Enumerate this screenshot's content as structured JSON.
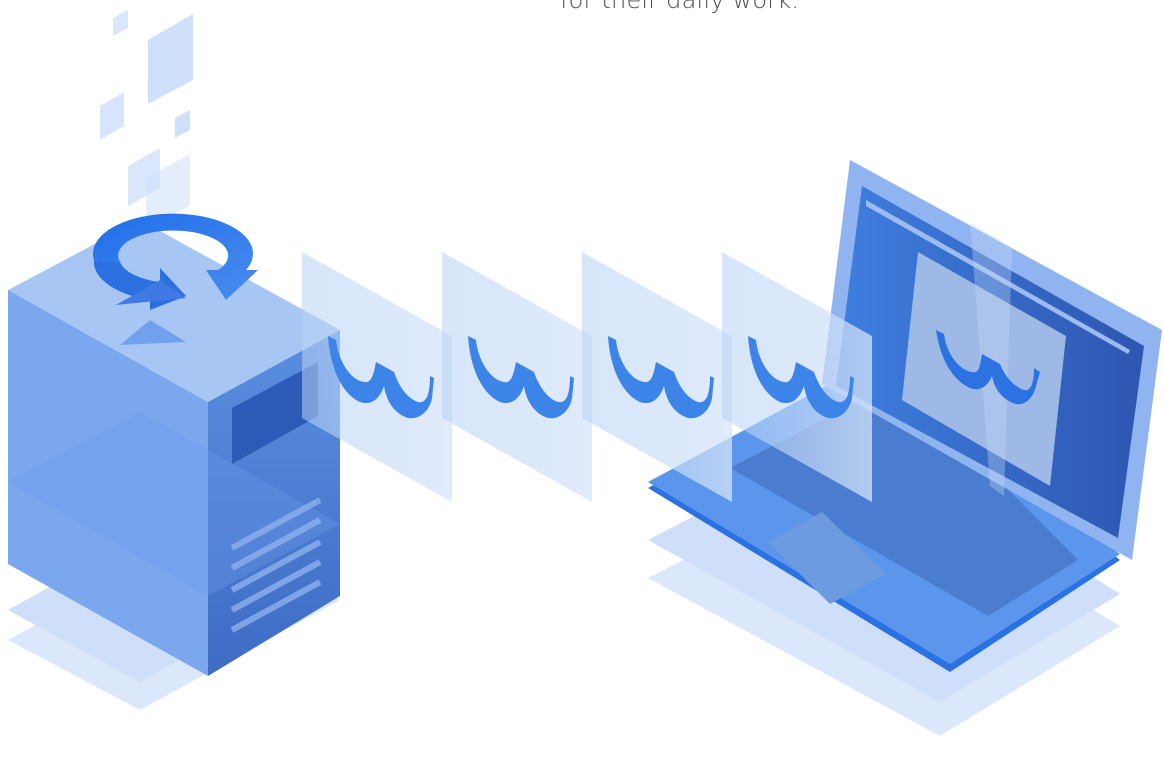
{
  "caption": {
    "text": "for their daily work."
  },
  "colors": {
    "primary": "#2b6fe0",
    "light": "#cfe0fb",
    "mid": "#78a6ef",
    "dark": "#3b5fb8",
    "glass": "#dce8f9"
  },
  "illustration": {
    "server_icon": "server-icon",
    "sync_icon": "sync-arrows-icon",
    "laptop_icon": "laptop-icon",
    "glasses_icon": "glasses-icon",
    "glasses_count": 4
  }
}
